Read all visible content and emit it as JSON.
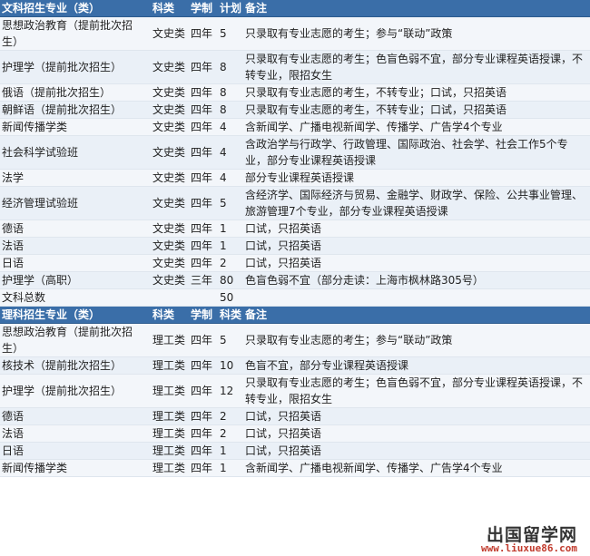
{
  "arts": {
    "header": [
      "文科招生专业（类）",
      "科类",
      "学制",
      "计划",
      "备注"
    ],
    "rows": [
      [
        "思想政治教育（提前批次招生）",
        "文史类",
        "四年",
        "5",
        "只录取有专业志愿的考生；参与“联动”政策"
      ],
      [
        "护理学（提前批次招生）",
        "文史类",
        "四年",
        "8",
        "只录取有专业志愿的考生；色盲色弱不宜，部分专业课程英语授课，不转专业，限招女生"
      ],
      [
        "俄语（提前批次招生）",
        "文史类",
        "四年",
        "8",
        "只录取有专业志愿的考生，不转专业；口试，只招英语"
      ],
      [
        "朝鲜语（提前批次招生）",
        "文史类",
        "四年",
        "8",
        "只录取有专业志愿的考生，不转专业；口试，只招英语"
      ],
      [
        "新闻传播学类",
        "文史类",
        "四年",
        "4",
        "含新闻学、广播电视新闻学、传播学、广告学4个专业"
      ],
      [
        "社会科学试验班",
        "文史类",
        "四年",
        "4",
        "含政治学与行政学、行政管理、国际政治、社会学、社会工作5个专业，部分专业课程英语授课"
      ],
      [
        "法学",
        "文史类",
        "四年",
        "4",
        "部分专业课程英语授课"
      ],
      [
        "经济管理试验班",
        "文史类",
        "四年",
        "5",
        "含经济学、国际经济与贸易、金融学、财政学、保险、公共事业管理、旅游管理7个专业，部分专业课程英语授课"
      ],
      [
        "德语",
        "文史类",
        "四年",
        "1",
        "口试，只招英语"
      ],
      [
        "法语",
        "文史类",
        "四年",
        "1",
        "口试，只招英语"
      ],
      [
        "日语",
        "文史类",
        "四年",
        "2",
        "口试，只招英语"
      ],
      [
        "护理学（高职）",
        "文史类",
        "三年",
        "80",
        "色盲色弱不宜（部分走读：上海市枫林路305号）"
      ],
      [
        "文科总数",
        "",
        "",
        "50",
        ""
      ]
    ]
  },
  "science": {
    "header": [
      "理科招生专业（类）",
      "科类",
      "学制",
      "科类",
      "备注"
    ],
    "rows": [
      [
        "思想政治教育（提前批次招生）",
        "理工类",
        "四年",
        "5",
        "只录取有专业志愿的考生；参与“联动”政策"
      ],
      [
        "核技术（提前批次招生）",
        "理工类",
        "四年",
        "10",
        "色盲不宜，部分专业课程英语授课"
      ],
      [
        "护理学（提前批次招生）",
        "理工类",
        "四年",
        "12",
        "只录取有专业志愿的考生；色盲色弱不宜，部分专业课程英语授课，不转专业，限招女生"
      ],
      [
        "德语",
        "理工类",
        "四年",
        "2",
        "口试，只招英语"
      ],
      [
        "法语",
        "理工类",
        "四年",
        "2",
        "口试，只招英语"
      ],
      [
        "日语",
        "理工类",
        "四年",
        "1",
        "口试，只招英语"
      ],
      [
        "新闻传播学类",
        "理工类",
        "四年",
        "1",
        "含新闻学、广播电视新闻学、传播学、广告学4个专业"
      ]
    ]
  },
  "watermark": {
    "site_name": "出国留学网",
    "url": "www.liuxue86.com"
  }
}
